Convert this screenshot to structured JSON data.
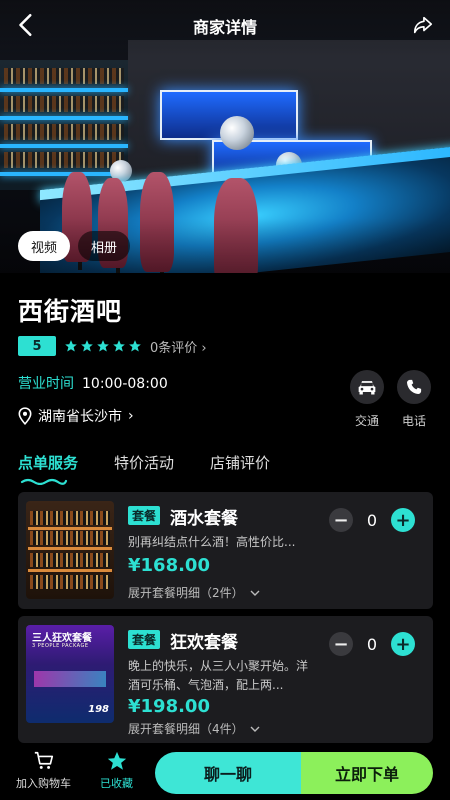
{
  "header": {
    "title": "商家详情"
  },
  "media_tabs": [
    {
      "label": "视频"
    },
    {
      "label": "相册"
    }
  ],
  "shop": {
    "name": "西街酒吧",
    "rating": "5",
    "stars": 5,
    "reviews": "0条评价",
    "hours_label": "营业时间",
    "hours": "10:00-08:00",
    "address": "湖南省长沙市"
  },
  "quick_actions": [
    {
      "label": "交通",
      "icon": "car-icon"
    },
    {
      "label": "电话",
      "icon": "phone-icon"
    }
  ],
  "tabs": [
    {
      "label": "点单服务"
    },
    {
      "label": "特价活动"
    },
    {
      "label": "店铺评价"
    }
  ],
  "packages": [
    {
      "badge": "套餐",
      "title": "酒水套餐",
      "desc": "别再纠结点什么酒！高性价比...",
      "price": "¥168.00",
      "expand": "展开套餐明细（2件）",
      "qty": "0"
    },
    {
      "badge": "套餐",
      "title": "狂欢套餐",
      "desc": "晚上的快乐，从三人小聚开始。洋酒可乐桶、气泡酒，配上两...",
      "price": "¥198.00",
      "expand": "展开套餐明细（4件）",
      "qty": "0",
      "thumb_title": "三人狂欢套餐",
      "thumb_sub": "3 PEOPLE PACKAGE",
      "thumb_price": "198"
    }
  ],
  "bottom_bar": {
    "cart": "加入购物车",
    "collected": "已收藏",
    "chat": "聊一聊",
    "order": "立即下单"
  },
  "colors": {
    "accent": "#2de0d2",
    "green": "#8cf05b",
    "star": "#2de0d2"
  }
}
